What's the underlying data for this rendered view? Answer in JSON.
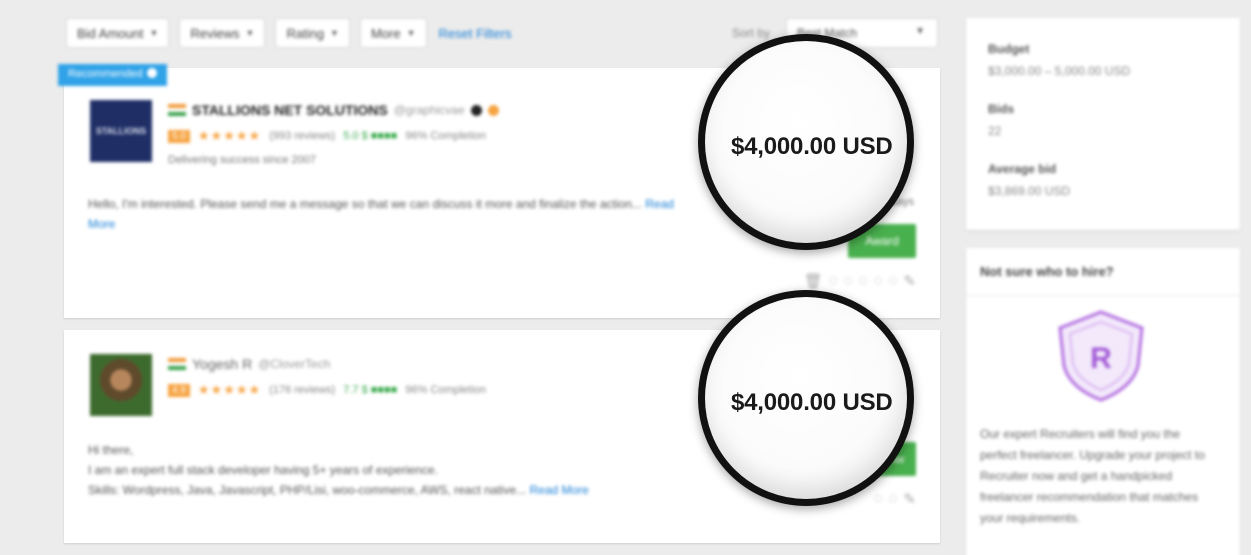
{
  "filters": {
    "buttons": [
      {
        "label": "Bid Amount"
      },
      {
        "label": "Reviews"
      },
      {
        "label": "Rating"
      },
      {
        "label": "More"
      }
    ],
    "reset_label": "Reset Filters",
    "sort_label": "Sort by",
    "sort_value": "Best Match"
  },
  "bids": [
    {
      "badge": "Recommended",
      "avatar_text": "STALLIONS",
      "name": "STALLIONS NET SOLUTIONS",
      "handle": "@graphicvae",
      "score": "5.0",
      "stars": "★★★★★",
      "reviews": "(993 reviews)",
      "earnings": "5.0 $ ■■■■",
      "completion": "96% Completion",
      "tagline": "Delivering success since 2007",
      "description": "Hello, I'm interested. Please send me a message so that we can discuss it more and finalize the action...",
      "read_more": "Read More",
      "amount": "$4,000.00 USD",
      "duration": "in 7 days",
      "award_label": "Award",
      "colors": {
        "badge": "#2fa2e8",
        "award": "#49b04e"
      }
    },
    {
      "name": "Yogesh R",
      "handle": "@CloverTech",
      "score": "4.9",
      "stars": "★★★★★",
      "reviews": "(176 reviews)",
      "earnings": "7.7 $ ■■■■",
      "completion": "96% Completion",
      "description_lines": [
        "Hi there,",
        "I am an expert full stack developer having 5+ years of experience.",
        "Skills: Wordpress, Java, Javascript, PHP/Lisi, woo-commerce, AWS, react native..."
      ],
      "read_more": "Read More",
      "amount": "$4,000.00 USD",
      "award_label": "Aw"
    }
  ],
  "project_summary": {
    "budget_label": "Budget",
    "budget_value": "$3,000.00 – 5,000.00 USD",
    "bids_label": "Bids",
    "bids_value": "22",
    "average_label": "Average bid",
    "average_value": "$3,869.00 USD"
  },
  "help_panel": {
    "title": "Not sure who to hire?",
    "icon": "shield-r-icon",
    "text": "Our expert Recruiters will find you the perfect freelancer. Upgrade your project to Recruiter now and get a handpicked freelancer recommendation that matches your requirements."
  }
}
